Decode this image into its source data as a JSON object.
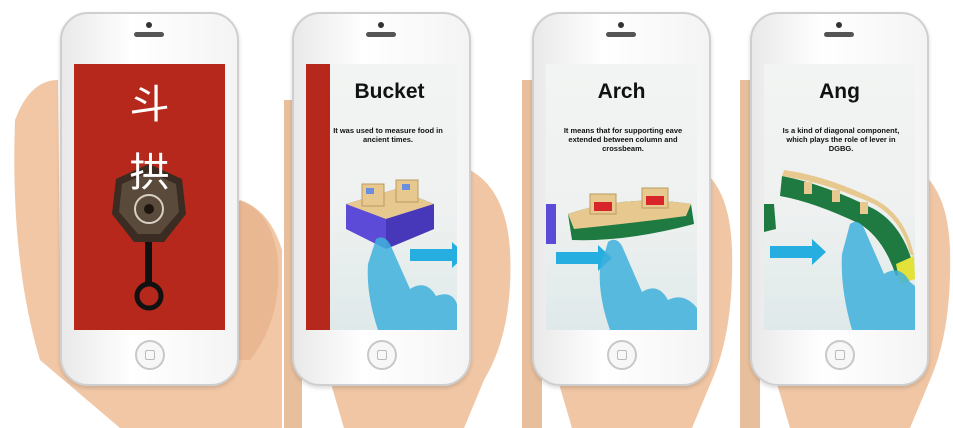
{
  "panels": [
    {
      "characters": [
        "斗",
        "拱"
      ]
    },
    {
      "title": "Bucket",
      "desc": "It was used to measure food in ancient times."
    },
    {
      "title": "Arch",
      "desc": "It means that for supporting eave extended between column and crossbeam."
    },
    {
      "title": "Ang",
      "desc": "Is a kind of diagonal component, which plays the role of lever in DGBG."
    }
  ],
  "colors": {
    "door_red": "#b6281c",
    "arrow": "#27aee0",
    "finger": "#3fb0dc",
    "wood": "#e7c98f",
    "purple": "#5b4bd6",
    "green": "#1e7a40",
    "red_block": "#d8252a"
  }
}
